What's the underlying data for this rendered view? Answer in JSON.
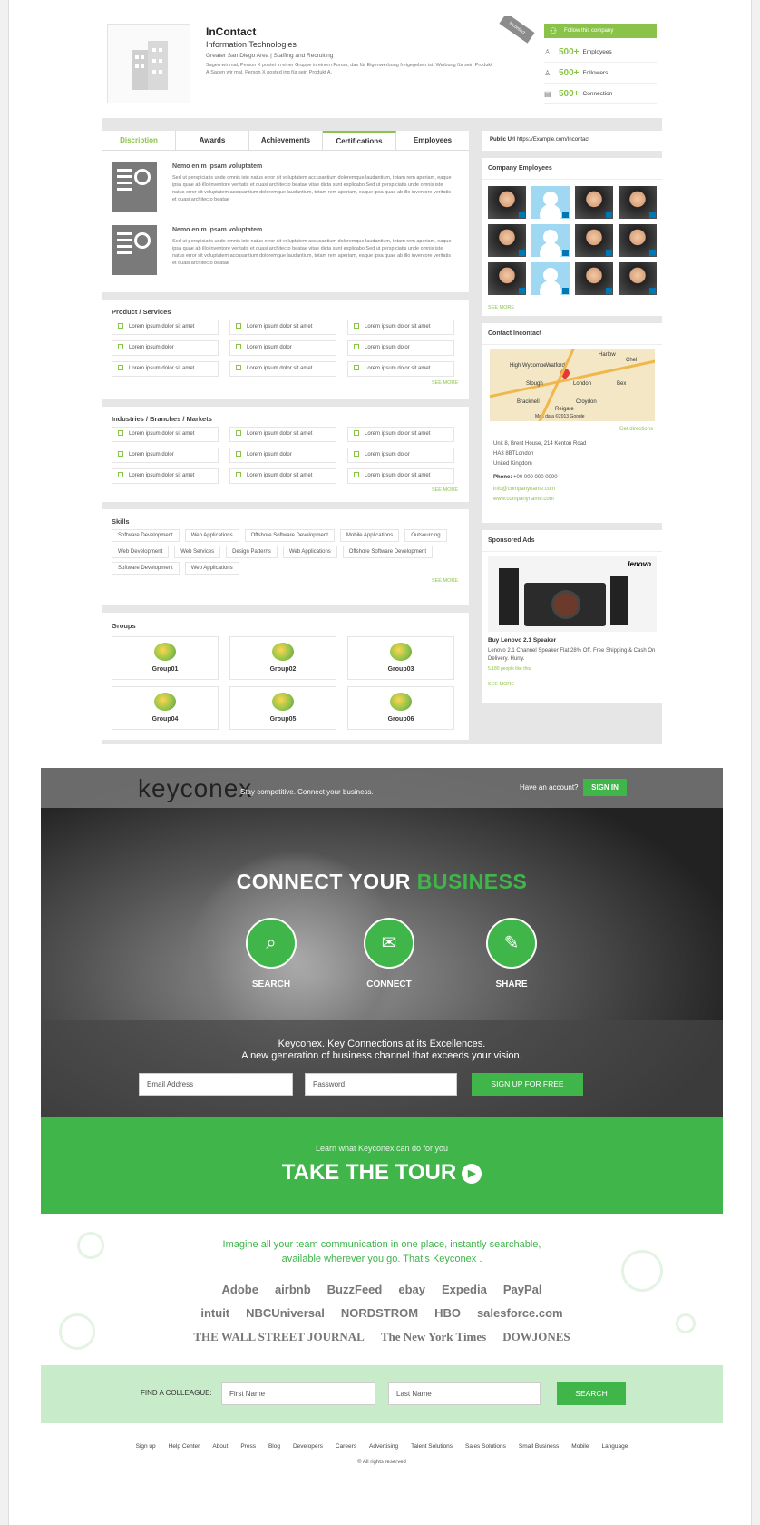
{
  "profile": {
    "name": "InContact",
    "industry": "Information Technologies",
    "location": "Greater San Diego Area | Staffing and Recruiting",
    "description": "Sagen wir mal, Person X postet in einer Gruppe in einem Forum, das für Eigenwerbung freigegeben ist. Werbung für sein Produkt A.Sagen wir mal, Person X posted ing für sein Produkt A.",
    "ribbon": "Incontact",
    "follow_label": "Follow this company",
    "stats": [
      {
        "icon": "employees-icon",
        "value": "500+",
        "label": "Employees"
      },
      {
        "icon": "followers-icon",
        "value": "500+",
        "label": "Followers"
      },
      {
        "icon": "connection-icon",
        "value": "500+",
        "label": "Connection"
      }
    ],
    "tabs": [
      "Discription",
      "Awards",
      "Achievements",
      "Certifications",
      "Employees"
    ],
    "active_tab": 3,
    "certifications": [
      {
        "title": "Nemo enim ipsam voluptatem",
        "text": "Sed ut perspiciatis unde omnis iste natus error sit voluptatem accusantium doloremque laudantium, totam rem aperiam, eaque ipsa quae ab illo inventore veritatis et quasi architecto beatae vitae dicta sunt explicabo Sed ut perspiciatis unde omnis iste natus error sit voluptatem accusantium doloremque laudantium, totam rem aperiam, eaque ipsa quae ab illo inventore veritatis et quasi architecto beatae"
      },
      {
        "title": "Nemo enim ipsam voluptatem",
        "text": "Sed ut perspiciatis unde omnis iste natus error sit voluptatem accusantium doloremque laudantium, totam rem aperiam, eaque ipsa quae ab illo inventore veritatis et quasi architecto beatae vitae dicta sunt explicabo Sed ut perspiciatis unde omnis iste natus error sit voluptatem accusantium doloremque laudantium, totam rem aperiam, eaque ipsa quae ab illo inventore veritatis et quasi architecto beatae"
      }
    ],
    "products_title": "Product / Services",
    "products": [
      "Lorem ipsum dolor sit amet",
      "Lorem ipsum dolor sit amet",
      "Lorem ipsum dolor sit amet",
      "Lorem ipsum dolor",
      "Lorem ipsum dolor",
      "Lorem ipsum dolor",
      "Lorem ipsum dolor sit amet",
      "Lorem ipsum dolor sit amet",
      "Lorem ipsum dolor sit amet"
    ],
    "industries_title": "Industries / Branches / Markets",
    "industries": [
      "Lorem ipsum dolor sit amet",
      "Lorem ipsum dolor sit amet",
      "Lorem ipsum dolor sit amet",
      "Lorem ipsum dolor",
      "Lorem ipsum dolor",
      "Lorem ipsum dolor",
      "Lorem ipsum dolor sit amet",
      "Lorem ipsum dolor sit amet",
      "Lorem ipsum dolor sit amet"
    ],
    "see_more": "SEE MORE",
    "skills_title": "Skills",
    "skills": [
      "Software Development",
      "Web Applications",
      "Offshore Software Development",
      "Mobile Applications",
      "Outsourcing",
      "Web Development",
      "Web Services",
      "Design Patterns",
      "Web Applications",
      "Offshore Software Development",
      "Software Development",
      "Web Applications"
    ],
    "groups_title": "Groups",
    "groups": [
      "Group01",
      "Group02",
      "Group03",
      "Group04",
      "Group05",
      "Group06"
    ],
    "public_url_label": "Public Url",
    "public_url": "https://Example.com/Incontact",
    "employees_title": "Company Employees",
    "employees": [
      "male",
      "blank",
      "male",
      "male",
      "male",
      "blank",
      "male",
      "male",
      "male",
      "blank",
      "male",
      "male"
    ],
    "contact_title": "Contact Incontact",
    "map_labels": [
      "Harlow",
      "High Wycombe",
      "Watford",
      "Chel",
      "Slough",
      "London",
      "Bracknell",
      "Croydon",
      "Reigate",
      "Bex"
    ],
    "map_footer": "Map data ©2013 Google",
    "get_directions": "Get directions",
    "address": [
      "Unit 8, Brent House, 214 Kenton Road",
      "HA3 8BTLondon",
      "United Kingdom"
    ],
    "phone_label": "Phone:",
    "phone": "+00 000 000 0000",
    "email": "info@companyname.com",
    "website": "www.companyname.com",
    "ads_title": "Sponsored Ads",
    "ad_brand": "lenovo",
    "ad_title": "Buy Lenovo 2.1 Speaker",
    "ad_text": "Lenovo 2.1 Channel Speaker Flat 28% Off. Free Shipping & Cash On Delivery. Hurry.",
    "ad_likes": "5,180 people like this.",
    "ad_more": "SEE MORE"
  },
  "landing": {
    "logo": "keyconex",
    "tagline": "Stay competitive. Connect your business.",
    "have_account": "Have an account?",
    "signin": "SIGN IN",
    "hero_title_1": "CONNECT YOUR",
    "hero_title_2": "BUSINESS",
    "features": [
      {
        "icon": "search-doc-icon",
        "label": "SEARCH"
      },
      {
        "icon": "chat-bubble-icon",
        "label": "CONNECT"
      },
      {
        "icon": "share-icon",
        "label": "SHARE"
      }
    ],
    "band_line1": "Keyconex. Key Connections at its Excellences.",
    "band_line2": "A new generation of business channel that exceeds your vision.",
    "email_placeholder": "Email Address",
    "password_placeholder": "Password",
    "signup": "SIGN UP FOR FREE",
    "tour_lead": "Learn what Keyconex can do for you",
    "tour_title": "TAKE THE TOUR",
    "msg_line1": "Imagine all your team communication in one place, instantly searchable,",
    "msg_line2": "available wherever you go. That's Keyconex .",
    "logo_rows": [
      [
        "Adobe",
        "airbnb",
        "BuzzFeed",
        "ebay",
        "Expedia",
        "PayPal"
      ],
      [
        "intuit",
        "NBCUniversal",
        "NORDSTROM",
        "HBO",
        "salesforce.com"
      ],
      [
        "THE WALL STREET JOURNAL",
        "The New York Times",
        "DOWJONES"
      ]
    ],
    "find_label": "FIND A COLLEAGUE:",
    "first_name": "First Name",
    "last_name": "Last Name",
    "search": "SEARCH",
    "footer_links": [
      "Sign up",
      "Help Center",
      "About",
      "Press",
      "Blog",
      "Developers",
      "Careers",
      "Advertising",
      "Talent Solutions",
      "Sales Solutions",
      "Small Business",
      "Mobile",
      "Language"
    ],
    "copyright": "© All rights reserved"
  }
}
